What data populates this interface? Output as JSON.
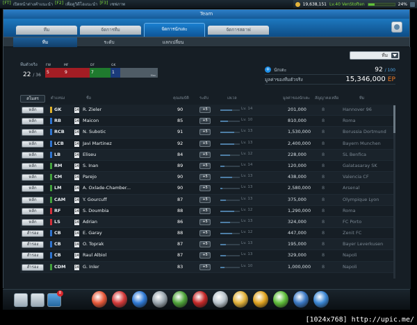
{
  "ticker": [
    {
      "tag": "[FT]",
      "text": "เปิดหน้าต่างคำแนะนำ"
    },
    {
      "tag": "[F2]",
      "text": "เพื่อดูวิดีโอแนะนำ"
    },
    {
      "tag": "[F3]",
      "text": "เซฟภาพ"
    }
  ],
  "status": {
    "money": "19,638,151",
    "level": "Lv.40 VenStoften",
    "xp_fraction": 0.24,
    "xp_label": "24%"
  },
  "window": {
    "title": "Team"
  },
  "main_tabs": [
    "ทีม",
    "จัดการทีม",
    "จัดการนักเตะ",
    "จัดการสตาฟ"
  ],
  "active_main_tab": 2,
  "sub_tabs": [
    "ทีม",
    "ระดับ",
    "แลกเปลี่ยน"
  ],
  "active_sub_tab": 0,
  "filter": {
    "selected": "ทีม"
  },
  "team": {
    "label": "ทีมตัวจริง",
    "current": "22",
    "max": "/ 36",
    "positions": [
      {
        "label": "FW",
        "count": "5",
        "color": "#a31d24"
      },
      {
        "label": "MF",
        "count": "9",
        "color": "#a31d24"
      },
      {
        "label": "DF",
        "count": "7",
        "color": "#1f7a2e"
      },
      {
        "label": "GK",
        "count": "1",
        "color": "#1b3b7b"
      }
    ],
    "bar_max_label": "Max"
  },
  "players_info": {
    "label": "นักเตะ",
    "count": "92",
    "max": "/ 100"
  },
  "value_info": {
    "label": "มูลค่าของทีมตัวจริง",
    "value": "15,346,000",
    "unit": "EP"
  },
  "table": {
    "sort_label": "สโมสร",
    "columns": [
      "ตำแหน่ง",
      "ชื่อ",
      "คุณสมบัติ",
      "ระดับ",
      "เลเวล",
      "มูลค่าของนักเตะ",
      "สัญญาคงเหลือ",
      "ทีม"
    ],
    "rows": [
      {
        "role": "หลัก",
        "pos": "GK",
        "pos_color": "#e0b32a",
        "name": "R. Zieler",
        "ovr": "90",
        "bonus": "+5",
        "level": "Lv. 14",
        "level_frac": 0.6,
        "price": "201,000",
        "contract": "8",
        "club": "Hannover 96"
      },
      {
        "role": "หลัก",
        "pos": "RB",
        "pos_color": "#2f74d0",
        "name": "Maicon",
        "ovr": "85",
        "bonus": "+5",
        "level": "Lv. 10",
        "level_frac": 0.4,
        "price": "810,000",
        "contract": "8",
        "club": "Roma"
      },
      {
        "role": "หลัก",
        "pos": "RCB",
        "pos_color": "#2f74d0",
        "name": "N. Subotic",
        "ovr": "91",
        "bonus": "+5",
        "level": "Lv. 13",
        "level_frac": 0.7,
        "price": "1,530,000",
        "contract": "8",
        "club": "Borussia Dortmund"
      },
      {
        "role": "หลัก",
        "pos": "LCB",
        "pos_color": "#2f74d0",
        "name": "Javi Martinez",
        "ovr": "92",
        "bonus": "+5",
        "level": "Lv. 13",
        "level_frac": 0.7,
        "price": "2,400,000",
        "contract": "8",
        "club": "Bayern Munchen"
      },
      {
        "role": "หลัก",
        "pos": "LB",
        "pos_color": "#2f74d0",
        "name": "Eliseu",
        "ovr": "84",
        "bonus": "+5",
        "level": "Lv. 12",
        "level_frac": 0.5,
        "price": "228,000",
        "contract": "8",
        "club": "SL Benfica"
      },
      {
        "role": "หลัก",
        "pos": "RM",
        "pos_color": "#43a23d",
        "name": "S. Inan",
        "ovr": "89",
        "bonus": "+5",
        "level": "Lv. 14",
        "level_frac": 0.2,
        "price": "120,000",
        "contract": "8",
        "club": "Galatasaray SK"
      },
      {
        "role": "หลัก",
        "pos": "CM",
        "pos_color": "#43a23d",
        "name": "Parejo",
        "ovr": "90",
        "bonus": "+5",
        "level": "Lv. 13",
        "level_frac": 0.6,
        "price": "438,000",
        "contract": "8",
        "club": "Valencia CF"
      },
      {
        "role": "หลัก",
        "pos": "LM",
        "pos_color": "#43a23d",
        "name": "A. Oxlade-Chamber...",
        "ovr": "90",
        "bonus": "+5",
        "level": "Lv. 13",
        "level_frac": 0.1,
        "price": "2,580,000",
        "contract": "8",
        "club": "Arsenal"
      },
      {
        "role": "หลัก",
        "pos": "CAM",
        "pos_color": "#43a23d",
        "name": "Y. Gourcuff",
        "ovr": "87",
        "bonus": "+5",
        "level": "Lv. 13",
        "level_frac": 0.3,
        "price": "375,000",
        "contract": "8",
        "club": "Olympique Lyon"
      },
      {
        "role": "หลัก",
        "pos": "RF",
        "pos_color": "#d3303a",
        "name": "S. Doumbia",
        "ovr": "88",
        "bonus": "+5",
        "level": "Lv. 12",
        "level_frac": 0.7,
        "price": "1,290,000",
        "contract": "8",
        "club": "Roma"
      },
      {
        "role": "หลัก",
        "pos": "LS",
        "pos_color": "#d3303a",
        "name": "Adrian",
        "ovr": "86",
        "bonus": "+5",
        "level": "Lv. 13",
        "level_frac": 0.5,
        "price": "324,000",
        "contract": "8",
        "club": "FC Porto"
      },
      {
        "role": "สำรอง",
        "pos": "CB",
        "pos_color": "#2f74d0",
        "name": "E. Garay",
        "ovr": "88",
        "bonus": "+5",
        "level": "Lv. 12",
        "level_frac": 0.6,
        "price": "447,000",
        "contract": "8",
        "club": "Zenit FC"
      },
      {
        "role": "สำรอง",
        "pos": "CB",
        "pos_color": "#2f74d0",
        "name": "O. Toprak",
        "ovr": "87",
        "bonus": "+5",
        "level": "Lv. 13",
        "level_frac": 0.3,
        "price": "195,000",
        "contract": "8",
        "club": "Bayer Leverkusen"
      },
      {
        "role": "สำรอง",
        "pos": "CB",
        "pos_color": "#2f74d0",
        "name": "Raul Albiol",
        "ovr": "87",
        "bonus": "+5",
        "level": "Lv. 13",
        "level_frac": 0.3,
        "price": "329,000",
        "contract": "8",
        "club": "Napoli"
      },
      {
        "role": "สำรอง",
        "pos": "CDM",
        "pos_color": "#43a23d",
        "name": "G. Inler",
        "ovr": "83",
        "bonus": "+5",
        "level": "Lv. 10",
        "level_frac": 0.2,
        "price": "1,000,000",
        "contract": "8",
        "club": "Napoli"
      }
    ]
  },
  "taskbar": {
    "badge": "8",
    "icons": [
      {
        "name": "whistle-icon",
        "color": "#e85a3b"
      },
      {
        "name": "ball-icon",
        "color": "#d43a3a"
      },
      {
        "name": "boots-icon",
        "color": "#2f7ad6"
      },
      {
        "name": "trophy-icon",
        "color": "#9aa6ae"
      },
      {
        "name": "league-icon",
        "color": "#4fa43a"
      },
      {
        "name": "live-icon",
        "color": "#c52828"
      },
      {
        "name": "news-icon",
        "color": "#b9c4cc"
      },
      {
        "name": "jersey-icon",
        "color": "#e2b23a"
      },
      {
        "name": "coin-icon",
        "color": "#e0a420"
      },
      {
        "name": "club-icon",
        "color": "#5fbe3a"
      },
      {
        "name": "compass-icon",
        "color": "#3a78c4"
      },
      {
        "name": "cart-icon",
        "color": "#3a86d4"
      }
    ]
  },
  "watermark": "[1024x768] http://upic.me/"
}
